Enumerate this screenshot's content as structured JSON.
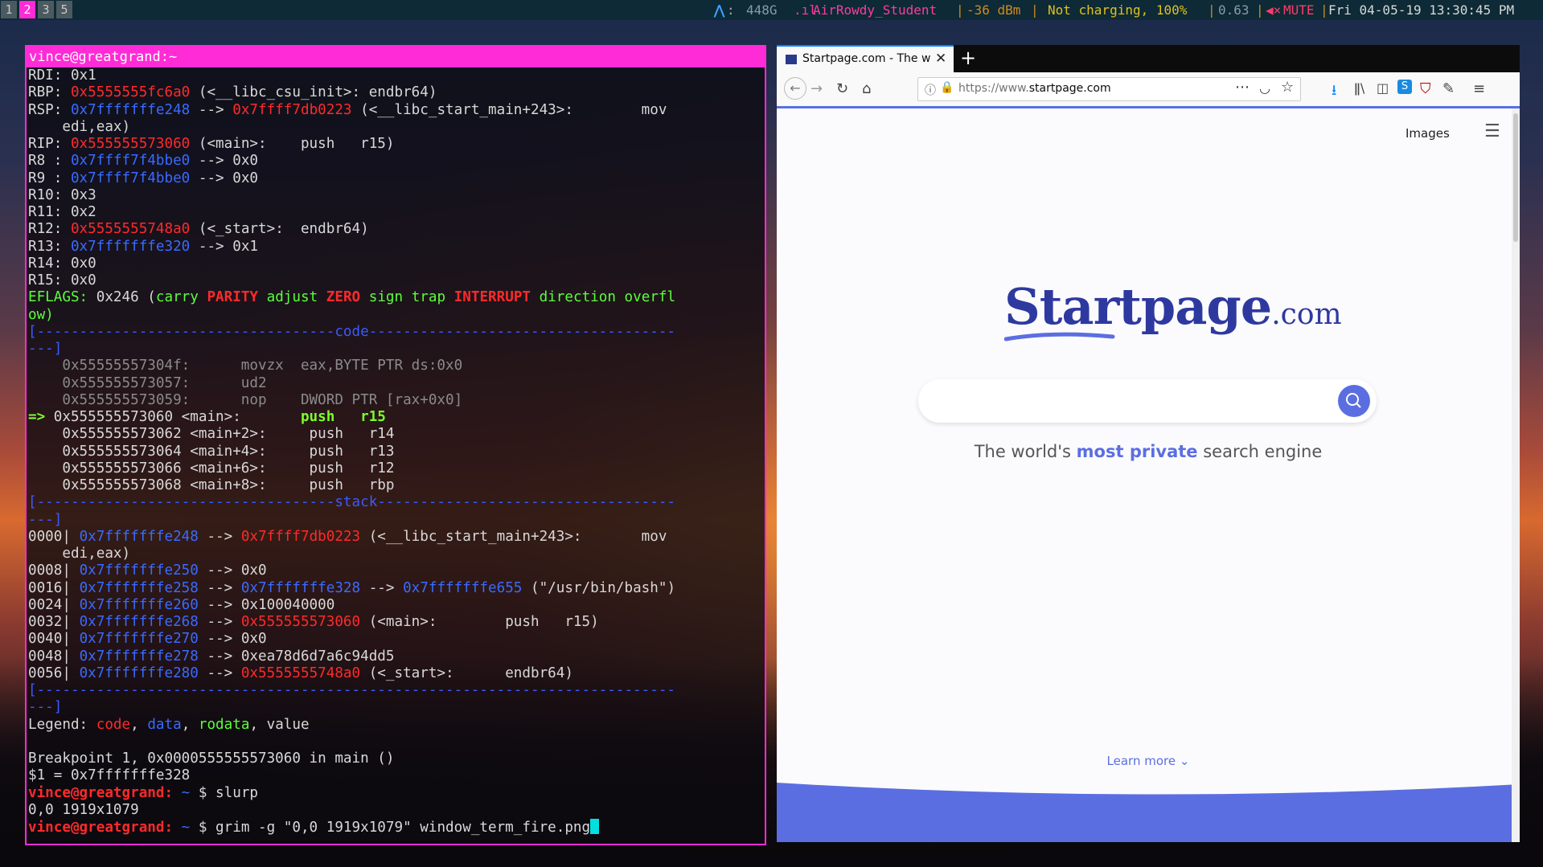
{
  "statusbar": {
    "workspaces": [
      "1",
      "2",
      "3",
      "5"
    ],
    "active_workspace": "2",
    "disk": "448G",
    "wifi_ssid": "AirRowdy_Student",
    "wifi_signal": "-36 dBm",
    "battery": "Not charging, 100%",
    "load": "0.63",
    "volume": "MUTE",
    "datetime": "Fri 04-05-19 13:30:45 PM"
  },
  "terminal": {
    "title": "vince@greatgrand:~",
    "lines": [
      [
        [
          "w",
          "RDI: 0x1"
        ]
      ],
      [
        [
          "w",
          "RBP: "
        ],
        [
          "r",
          "0x5555555fc6a0"
        ],
        [
          "w",
          " (<__libc_csu_init>: endbr64)"
        ]
      ],
      [
        [
          "w",
          "RSP: "
        ],
        [
          "b",
          "0x7fffffffe248"
        ],
        [
          "w",
          " --> "
        ],
        [
          "r",
          "0x7ffff7db0223"
        ],
        [
          "w",
          " (<__libc_start_main+243>:        mov"
        ]
      ],
      [
        [
          "w",
          "    edi,eax)"
        ]
      ],
      [
        [
          "w",
          "RIP: "
        ],
        [
          "r",
          "0x555555573060"
        ],
        [
          "w",
          " (<main>:    push   r15)"
        ]
      ],
      [
        [
          "w",
          "R8 : "
        ],
        [
          "b",
          "0x7ffff7f4bbe0"
        ],
        [
          "w",
          " --> 0x0"
        ]
      ],
      [
        [
          "w",
          "R9 : "
        ],
        [
          "b",
          "0x7ffff7f4bbe0"
        ],
        [
          "w",
          " --> 0x0"
        ]
      ],
      [
        [
          "w",
          "R10: 0x3"
        ]
      ],
      [
        [
          "w",
          "R11: 0x2"
        ]
      ],
      [
        [
          "w",
          "R12: "
        ],
        [
          "r",
          "0x5555555748a0"
        ],
        [
          "w",
          " (<_start>:  endbr64)"
        ]
      ],
      [
        [
          "w",
          "R13: "
        ],
        [
          "b",
          "0x7fffffffe320"
        ],
        [
          "w",
          " --> 0x1"
        ]
      ],
      [
        [
          "w",
          "R14: 0x0"
        ]
      ],
      [
        [
          "w",
          "R15: 0x0"
        ]
      ],
      [
        [
          "g",
          "EFLAGS: "
        ],
        [
          "w",
          "0x246 ("
        ],
        [
          "g",
          "carry "
        ],
        [
          "rb",
          "PARITY"
        ],
        [
          "g",
          " adjust "
        ],
        [
          "rb",
          "ZERO"
        ],
        [
          "g",
          " sign trap "
        ],
        [
          "rb",
          "INTERRUPT"
        ],
        [
          "g",
          " direction overfl"
        ]
      ],
      [
        [
          "g",
          "ow)"
        ]
      ],
      [
        [
          "dash",
          "[-----------------------------------code------------------------------------"
        ]
      ],
      [
        [
          "dash",
          "---]"
        ]
      ],
      [
        [
          "gy",
          "    0x55555557304f:      movzx  eax,BYTE PTR ds:0x0"
        ]
      ],
      [
        [
          "gy",
          "    0x555555573057:      ud2"
        ]
      ],
      [
        [
          "gy",
          "    0x555555573059:      nop    DWORD PTR [rax+0x0]"
        ]
      ],
      [
        [
          "gb",
          "=> "
        ],
        [
          "w",
          "0x555555573060 <main>:       "
        ],
        [
          "gb",
          "push   r15"
        ]
      ],
      [
        [
          "w",
          "    0x555555573062 <main+2>:     push   r14"
        ]
      ],
      [
        [
          "w",
          "    0x555555573064 <main+4>:     push   r13"
        ]
      ],
      [
        [
          "w",
          "    0x555555573066 <main+6>:     push   r12"
        ]
      ],
      [
        [
          "w",
          "    0x555555573068 <main+8>:     push   rbp"
        ]
      ],
      [
        [
          "dash",
          "[-----------------------------------stack-----------------------------------"
        ]
      ],
      [
        [
          "dash",
          "---]"
        ]
      ],
      [
        [
          "w",
          "0000| "
        ],
        [
          "b",
          "0x7fffffffe248"
        ],
        [
          "w",
          " --> "
        ],
        [
          "r",
          "0x7ffff7db0223"
        ],
        [
          "w",
          " (<__libc_start_main+243>:       mov"
        ]
      ],
      [
        [
          "w",
          "    edi,eax)"
        ]
      ],
      [
        [
          "w",
          "0008| "
        ],
        [
          "b",
          "0x7fffffffe250"
        ],
        [
          "w",
          " --> 0x0"
        ]
      ],
      [
        [
          "w",
          "0016| "
        ],
        [
          "b",
          "0x7fffffffe258"
        ],
        [
          "w",
          " --> "
        ],
        [
          "b",
          "0x7fffffffe328"
        ],
        [
          "w",
          " --> "
        ],
        [
          "b",
          "0x7fffffffe655"
        ],
        [
          "w",
          " (\"/usr/bin/bash\")"
        ]
      ],
      [
        [
          "w",
          "0024| "
        ],
        [
          "b",
          "0x7fffffffe260"
        ],
        [
          "w",
          " --> 0x100040000"
        ]
      ],
      [
        [
          "w",
          "0032| "
        ],
        [
          "b",
          "0x7fffffffe268"
        ],
        [
          "w",
          " --> "
        ],
        [
          "r",
          "0x555555573060"
        ],
        [
          "w",
          " (<main>:        push   r15)"
        ]
      ],
      [
        [
          "w",
          "0040| "
        ],
        [
          "b",
          "0x7fffffffe270"
        ],
        [
          "w",
          " --> 0x0"
        ]
      ],
      [
        [
          "w",
          "0048| "
        ],
        [
          "b",
          "0x7fffffffe278"
        ],
        [
          "w",
          " --> 0xea78d6d7a6c94dd5"
        ]
      ],
      [
        [
          "w",
          "0056| "
        ],
        [
          "b",
          "0x7fffffffe280"
        ],
        [
          "w",
          " --> "
        ],
        [
          "r",
          "0x5555555748a0"
        ],
        [
          "w",
          " (<_start>:      endbr64)"
        ]
      ],
      [
        [
          "dash",
          "[---------------------------------------------------------------------------"
        ]
      ],
      [
        [
          "dash",
          "---]"
        ]
      ],
      [
        [
          "w",
          "Legend: "
        ],
        [
          "r",
          "code"
        ],
        [
          "w",
          ", "
        ],
        [
          "b",
          "data"
        ],
        [
          "w",
          ", "
        ],
        [
          "g",
          "rodata"
        ],
        [
          "w",
          ", value"
        ]
      ],
      [
        [
          "w",
          ""
        ]
      ],
      [
        [
          "w",
          "Breakpoint 1, 0x0000555555573060 in main ()"
        ]
      ],
      [
        [
          "w",
          "$1 = 0x7fffffffe328"
        ]
      ],
      [
        [
          "rb",
          "vince@greatgrand:"
        ],
        [
          "b",
          " ~ "
        ],
        [
          "w",
          "$ slurp"
        ]
      ],
      [
        [
          "w",
          "0,0 1919x1079"
        ]
      ],
      [
        [
          "rb",
          "vince@greatgrand:"
        ],
        [
          "b",
          " ~ "
        ],
        [
          "w",
          "$ grim -g \"0,0 1919x1079\" window_term_fire.png"
        ]
      ]
    ]
  },
  "browser": {
    "tab_title": "Startpage.com - The wor",
    "url_prefix": "https://www.",
    "url_domain": "startpage.com",
    "images_link": "Images",
    "logo_main": "Startpage",
    "logo_suffix": ".com",
    "search_placeholder": "",
    "tagline_pre": "The world's ",
    "tagline_bold": "most private",
    "tagline_post": " search engine",
    "learn_more": "Learn more",
    "colors": {
      "accent": "#5b6ee1",
      "logo": "#2e39a0",
      "border": "#ff2bd6"
    }
  }
}
